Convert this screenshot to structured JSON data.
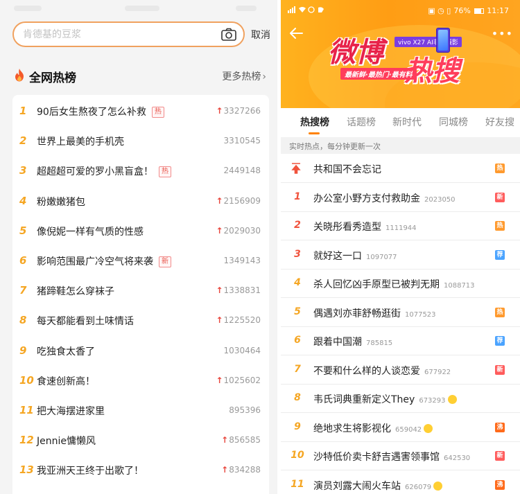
{
  "left": {
    "search": {
      "placeholder": "肯德基的豆浆",
      "camera_icon": "camera-icon"
    },
    "cancel_label": "取消",
    "section_title": "全网热榜",
    "more_label": "更多热榜",
    "accent_color": "#f5a623",
    "items": [
      {
        "rank": "1",
        "title": "90后女生熬夜了怎么补救",
        "badge": "热",
        "trend": "up",
        "count": "3327266"
      },
      {
        "rank": "2",
        "title": "世界上最美的手机壳",
        "badge": "",
        "trend": "",
        "count": "3310545"
      },
      {
        "rank": "3",
        "title": "超超超可爱的罗小黑盲盒！",
        "badge": "热",
        "trend": "",
        "count": "2449148"
      },
      {
        "rank": "4",
        "title": "粉嫩嫩猪包",
        "badge": "",
        "trend": "up",
        "count": "2156909"
      },
      {
        "rank": "5",
        "title": "像倪妮一样有气质的性感",
        "badge": "",
        "trend": "up",
        "count": "2029030"
      },
      {
        "rank": "6",
        "title": "影响范围最广冷空气将来袭",
        "badge": "新",
        "trend": "",
        "count": "1349143"
      },
      {
        "rank": "7",
        "title": "猪蹄鞋怎么穿袜子",
        "badge": "",
        "trend": "up",
        "count": "1338831"
      },
      {
        "rank": "8",
        "title": "每天都能看到土味情话",
        "badge": "",
        "trend": "up",
        "count": "1225520"
      },
      {
        "rank": "9",
        "title": "吃独食太香了",
        "badge": "",
        "trend": "",
        "count": "1030464"
      },
      {
        "rank": "10",
        "title": "食速创新高！",
        "badge": "",
        "trend": "up",
        "count": "1025602"
      },
      {
        "rank": "11",
        "title": "把大海摆进家里",
        "badge": "",
        "trend": "",
        "count": "895396"
      },
      {
        "rank": "12",
        "title": "Jennie慵懒风",
        "badge": "",
        "trend": "up",
        "count": "856585"
      },
      {
        "rank": "13",
        "title": "我亚洲天王终于出歌了！",
        "badge": "",
        "trend": "up",
        "count": "834288"
      }
    ]
  },
  "right": {
    "status": {
      "battery": "76%",
      "time": "11:17"
    },
    "banner": {
      "title_part1": "微博",
      "title_part2": "热搜",
      "device_tag": "vivo X27 AI非凡摄影",
      "tagline": "最新鲜·最热门·最有料"
    },
    "tabs": [
      "热搜榜",
      "话题榜",
      "新时代",
      "同城榜",
      "好友搜"
    ],
    "active_tab": 0,
    "notice": "实时热点，每分钟更新一次",
    "colors": {
      "hot": "#ff9a2e",
      "new": "#ff5c5c",
      "recommend": "#4aa3ff",
      "boil": "#ff6a1a"
    },
    "items": [
      {
        "rank": "",
        "pinned": true,
        "title": "共和国不会忘记",
        "count": "",
        "emoji": "",
        "badge": "热",
        "badge_type": "hot"
      },
      {
        "rank": "1",
        "pinned": false,
        "title": "办公室小野方支付救助金",
        "count": "2023050",
        "emoji": "",
        "badge": "新",
        "badge_type": "new"
      },
      {
        "rank": "2",
        "pinned": false,
        "title": "关晓彤看秀造型",
        "count": "1111944",
        "emoji": "",
        "badge": "热",
        "badge_type": "hot"
      },
      {
        "rank": "3",
        "pinned": false,
        "title": "就好这一口",
        "count": "1097077",
        "emoji": "",
        "badge": "荐",
        "badge_type": "rec"
      },
      {
        "rank": "4",
        "pinned": false,
        "title": "杀人回忆凶手原型已被判无期",
        "count": "1088713",
        "emoji": "",
        "badge": "",
        "badge_type": ""
      },
      {
        "rank": "5",
        "pinned": false,
        "title": "偶遇刘亦菲舒畅逛街",
        "count": "1077523",
        "emoji": "",
        "badge": "热",
        "badge_type": "hot"
      },
      {
        "rank": "6",
        "pinned": false,
        "title": "跟着中国潮",
        "count": "785815",
        "emoji": "",
        "badge": "荐",
        "badge_type": "rec"
      },
      {
        "rank": "7",
        "pinned": false,
        "title": "不要和什么样的人谈恋爱",
        "count": "677922",
        "emoji": "",
        "badge": "新",
        "badge_type": "new"
      },
      {
        "rank": "8",
        "pinned": false,
        "title": "韦氏词典重新定义They",
        "count": "673293",
        "emoji": "smile",
        "badge": "",
        "badge_type": ""
      },
      {
        "rank": "9",
        "pinned": false,
        "title": "绝地求生将影视化",
        "count": "659042",
        "emoji": "cry",
        "badge": "沸",
        "badge_type": "boil"
      },
      {
        "rank": "10",
        "pinned": false,
        "title": "沙特低价卖卡舒吉遇害领事馆",
        "count": "642530",
        "emoji": "",
        "badge": "新",
        "badge_type": "new"
      },
      {
        "rank": "11",
        "pinned": false,
        "title": "演员刘露大闹火车站",
        "count": "626079",
        "emoji": "laugh",
        "badge": "沸",
        "badge_type": "boil"
      }
    ]
  }
}
